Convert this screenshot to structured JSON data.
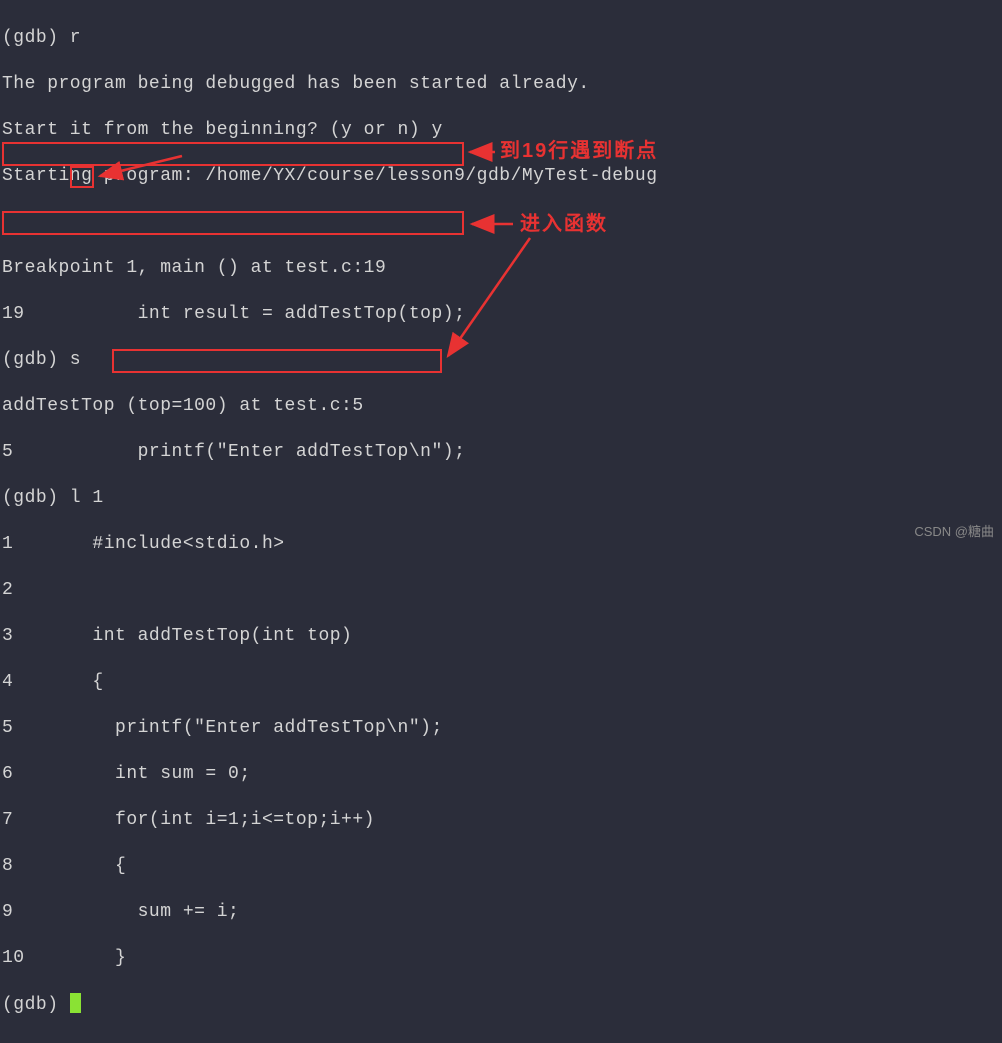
{
  "lines": {
    "l0": "(gdb) r",
    "l1": "The program being debugged has been started already.",
    "l2": "Start it from the beginning? (y or n) y",
    "l3": "Starting program: /home/YX/course/lesson9/gdb/MyTest-debug",
    "l4": "",
    "l5": "Breakpoint 1, main () at test.c:19",
    "l6": "19          int result = addTestTop(top);",
    "l7": "(gdb) s",
    "l8": "addTestTop (top=100) at test.c:5",
    "l9": "5           printf(\"Enter addTestTop\\n\");",
    "l10": "(gdb) l 1",
    "l11": "1       #include<stdio.h>",
    "l12": "2",
    "l13": "3       int addTestTop(int top)",
    "l14": "4       {",
    "l15": "5         printf(\"Enter addTestTop\\n\");",
    "l16": "6         int sum = 0;",
    "l17": "7         for(int i=1;i<=top;i++)",
    "l18": "8         {",
    "l19": "9           sum += i;",
    "l20": "10        }",
    "l21": "(gdb) "
  },
  "annotations": {
    "a1": "到19行遇到断点",
    "a2": "进入函数"
  },
  "watermark": "CSDN @糖曲"
}
